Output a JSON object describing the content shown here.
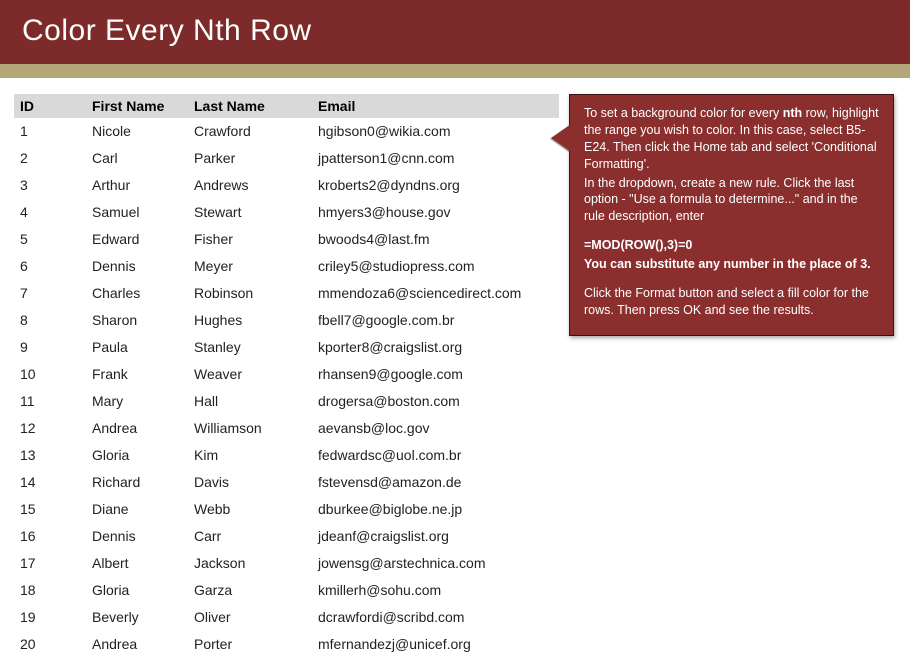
{
  "title": "Color Every Nth Row",
  "columns": {
    "id": "ID",
    "first": "First Name",
    "last": "Last Name",
    "email": "Email"
  },
  "rows": [
    {
      "id": "1",
      "first": "Nicole",
      "last": "Crawford",
      "email": "hgibson0@wikia.com"
    },
    {
      "id": "2",
      "first": "Carl",
      "last": "Parker",
      "email": "jpatterson1@cnn.com"
    },
    {
      "id": "3",
      "first": "Arthur",
      "last": "Andrews",
      "email": "kroberts2@dyndns.org"
    },
    {
      "id": "4",
      "first": "Samuel",
      "last": "Stewart",
      "email": "hmyers3@house.gov"
    },
    {
      "id": "5",
      "first": "Edward",
      "last": "Fisher",
      "email": "bwoods4@last.fm"
    },
    {
      "id": "6",
      "first": "Dennis",
      "last": "Meyer",
      "email": "criley5@studiopress.com"
    },
    {
      "id": "7",
      "first": "Charles",
      "last": "Robinson",
      "email": "mmendoza6@sciencedirect.com"
    },
    {
      "id": "8",
      "first": "Sharon",
      "last": "Hughes",
      "email": "fbell7@google.com.br"
    },
    {
      "id": "9",
      "first": "Paula",
      "last": "Stanley",
      "email": "kporter8@craigslist.org"
    },
    {
      "id": "10",
      "first": "Frank",
      "last": "Weaver",
      "email": "rhansen9@google.com"
    },
    {
      "id": "11",
      "first": "Mary",
      "last": "Hall",
      "email": "drogersa@boston.com"
    },
    {
      "id": "12",
      "first": "Andrea",
      "last": "Williamson",
      "email": "aevansb@loc.gov"
    },
    {
      "id": "13",
      "first": "Gloria",
      "last": "Kim",
      "email": "fedwardsc@uol.com.br"
    },
    {
      "id": "14",
      "first": "Richard",
      "last": "Davis",
      "email": "fstevensd@amazon.de"
    },
    {
      "id": "15",
      "first": "Diane",
      "last": "Webb",
      "email": "dburkee@biglobe.ne.jp"
    },
    {
      "id": "16",
      "first": "Dennis",
      "last": "Carr",
      "email": "jdeanf@craigslist.org"
    },
    {
      "id": "17",
      "first": "Albert",
      "last": "Jackson",
      "email": "jowensg@arstechnica.com"
    },
    {
      "id": "18",
      "first": "Gloria",
      "last": "Garza",
      "email": "kmillerh@sohu.com"
    },
    {
      "id": "19",
      "first": "Beverly",
      "last": "Oliver",
      "email": "dcrawfordi@scribd.com"
    },
    {
      "id": "20",
      "first": "Andrea",
      "last": "Porter",
      "email": "mfernandezj@unicef.org"
    }
  ],
  "callout": {
    "p1a": "To set a background color for every ",
    "p1b": "nth",
    "p1c": " row, highlight the range you wish to color. In this case, select B5-E24. Then click the Home tab and select 'Conditional Formatting'.",
    "p2": "In the dropdown, create a new rule. Click the last option - \"Use a formula to determine...\" and in the rule description, enter",
    "formula": "=MOD(ROW(),3)=0",
    "note": "You can substitute any number in the place of 3.",
    "p3": "Click the Format button and select a fill color for the rows. Then press OK and see the results."
  }
}
